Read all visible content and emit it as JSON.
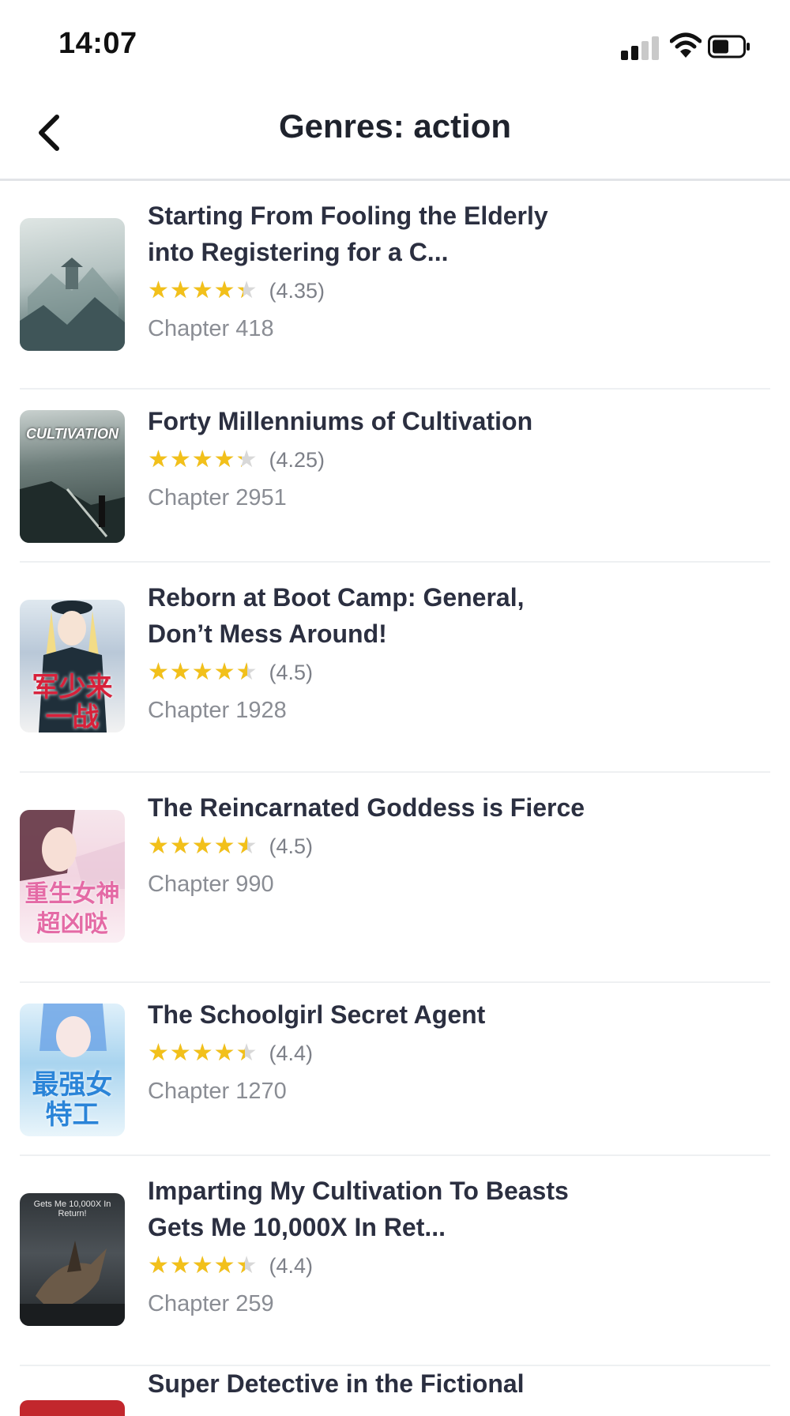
{
  "status_bar": {
    "time": "14:07"
  },
  "header": {
    "title": "Genres: action"
  },
  "books": [
    {
      "title": "Starting From Fooling the Elderly into Registering for a C...",
      "rating": 4.35,
      "rating_label": "(4.35)",
      "chapter": "Chapter 418"
    },
    {
      "title": "Forty Millenniums of Cultivation",
      "rating": 4.25,
      "rating_label": "(4.25)",
      "chapter": "Chapter 2951",
      "cover_text": "CULTIVATION"
    },
    {
      "title": "Reborn at Boot Camp: General, Don’t Mess Around!",
      "rating": 4.5,
      "rating_label": "(4.5)",
      "chapter": "Chapter 1928",
      "cover_text": "军少来一战"
    },
    {
      "title": "The Reincarnated Goddess is Fierce",
      "rating": 4.5,
      "rating_label": "(4.5)",
      "chapter": "Chapter 990",
      "cover_text": "重生女神超凶哒"
    },
    {
      "title": "The Schoolgirl Secret Agent",
      "rating": 4.4,
      "rating_label": "(4.4)",
      "chapter": "Chapter 1270",
      "cover_text": "最强女特工"
    },
    {
      "title": "Imparting My Cultivation To Beasts Gets Me 10,000X In Ret...",
      "rating": 4.4,
      "rating_label": "(4.4)",
      "chapter": "Chapter 259",
      "cover_text": "Gets Me 10,000X In Return!"
    }
  ],
  "partial_item": {
    "title": "Super Detective in the Fictional"
  },
  "icons": {
    "back": "chevron-left-icon",
    "signal": "cellular-signal-icon",
    "wifi": "wifi-icon",
    "battery": "battery-icon",
    "star": "star-icon"
  },
  "colors": {
    "star": "#f2c01a",
    "title": "#2b2f40",
    "meta": "#8a8d94"
  }
}
